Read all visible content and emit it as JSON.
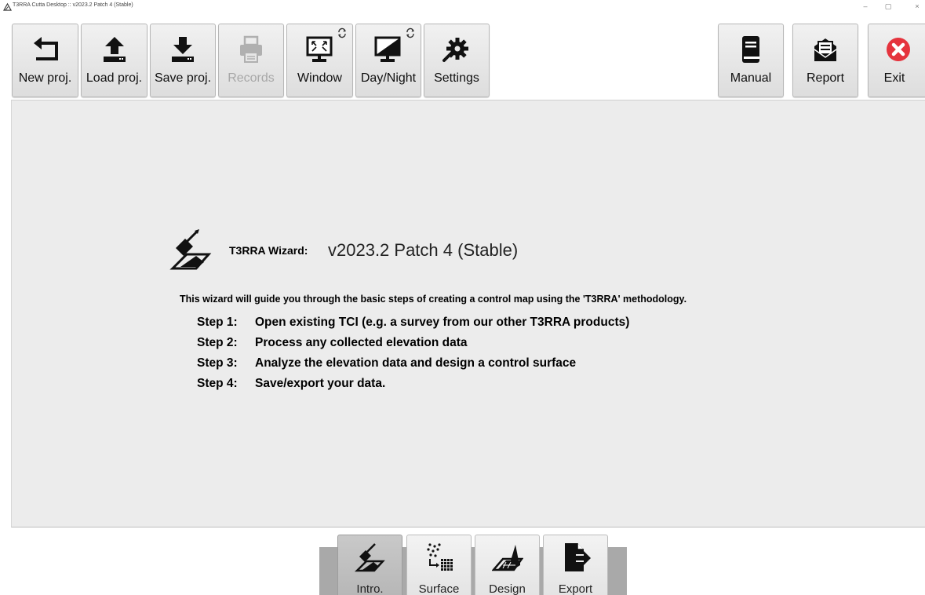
{
  "window": {
    "title": "T3RRA Cutta Desktop :: v2023.2 Patch 4 (Stable)",
    "controls": [
      "–",
      "▢",
      "×"
    ]
  },
  "toolbar": {
    "new_project": "New proj.",
    "load_project": "Load proj.",
    "save_project": "Save proj.",
    "records": "Records",
    "window": "Window",
    "day_night": "Day/Night",
    "settings": "Settings",
    "manual": "Manual",
    "report": "Report",
    "exit": "Exit"
  },
  "wizard": {
    "title": "T3RRA Wizard:",
    "version": "v2023.2 Patch 4 (Stable)",
    "intro": "This wizard will guide you through the basic steps of creating a control map using the 'T3RRA' methodology.",
    "steps": [
      {
        "num": "Step 1:",
        "text": "Open existing TCI (e.g. a survey from our other T3RRA products)"
      },
      {
        "num": "Step 2:",
        "text": "Process any collected elevation data"
      },
      {
        "num": "Step 3:",
        "text": "Analyze the elevation data and design a control surface"
      },
      {
        "num": "Step 4:",
        "text": "Save/export your data."
      }
    ]
  },
  "tabs": {
    "intro": "Intro.",
    "surface": "Surface",
    "design": "Design",
    "export": "Export",
    "active": "intro"
  },
  "colors": {
    "exit_icon": "#e5333d",
    "panel_bg": "#ececec"
  },
  "icons": {
    "new_project": "new-project-arrow-icon",
    "load_project": "upload-icon",
    "save_project": "download-icon",
    "records": "printer-icon",
    "window": "window-monitor-icon",
    "day_night": "day-night-monitor-icon",
    "settings": "gear-wrench-icon",
    "manual": "book-icon",
    "report": "report-envelope-icon",
    "exit": "exit-x-icon"
  }
}
